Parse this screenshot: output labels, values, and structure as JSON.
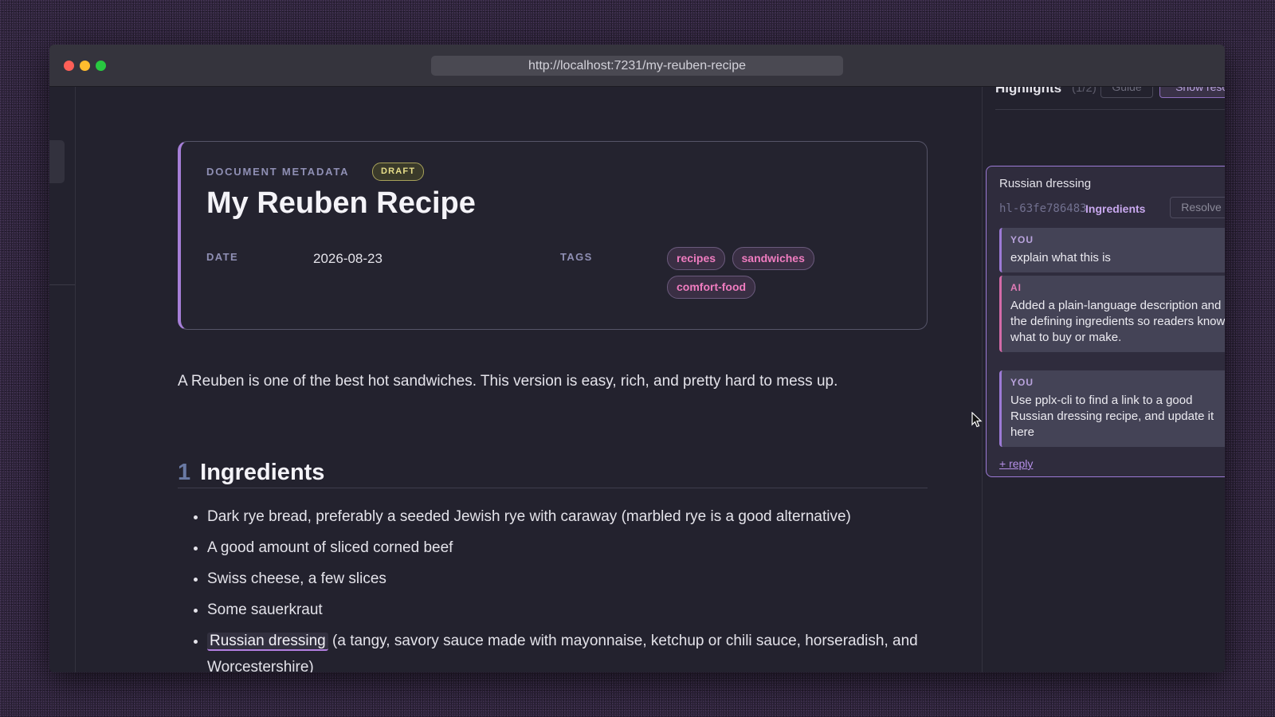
{
  "browser": {
    "url": "http://localhost:7231/my-reuben-recipe"
  },
  "metadata": {
    "section_label": "DOCUMENT METADATA",
    "badge": "DRAFT",
    "title": "My Reuben Recipe",
    "date_label": "DATE",
    "date_value": "2026-08-23",
    "tags_label": "TAGS",
    "tags": [
      "recipes",
      "sandwiches",
      "comfort-food"
    ]
  },
  "content": {
    "intro": "A Reuben is one of the best hot sandwiches. This version is easy, rich, and pretty hard to mess up.",
    "section_number": "1",
    "section_title": "Ingredients",
    "ingredients": [
      "Dark rye bread, preferably a seeded Jewish rye with caraway (marbled rye is a good alternative)",
      "A good amount of sliced corned beef",
      "Swiss cheese, a few slices",
      "Some sauerkraut"
    ],
    "highlight_item": {
      "highlight_text": "Russian dressing",
      "rest": " (a tangy, savory sauce made with mayonnaise, ketchup or chili sauce, horseradish, and Worcestershire)"
    }
  },
  "sidebar": {
    "title": "Highlights",
    "count": "(1/2)",
    "guide_label": "Guide",
    "show_resolved_label": "Show resolved",
    "card": {
      "title": "Russian dressing",
      "id": "hl-63fe786483",
      "section": "Ingredients",
      "resolve_label": "Resolve",
      "messages": [
        {
          "role": "YOU",
          "text": "explain what this is"
        },
        {
          "role": "AI",
          "text": "Added a plain-language description and the defining ingredients so readers know what to buy or make."
        },
        {
          "role": "YOU",
          "text": "Use pplx-cli to find a link to a good Russian dressing recipe, and update it here"
        }
      ],
      "reply_label": "+ reply"
    }
  }
}
